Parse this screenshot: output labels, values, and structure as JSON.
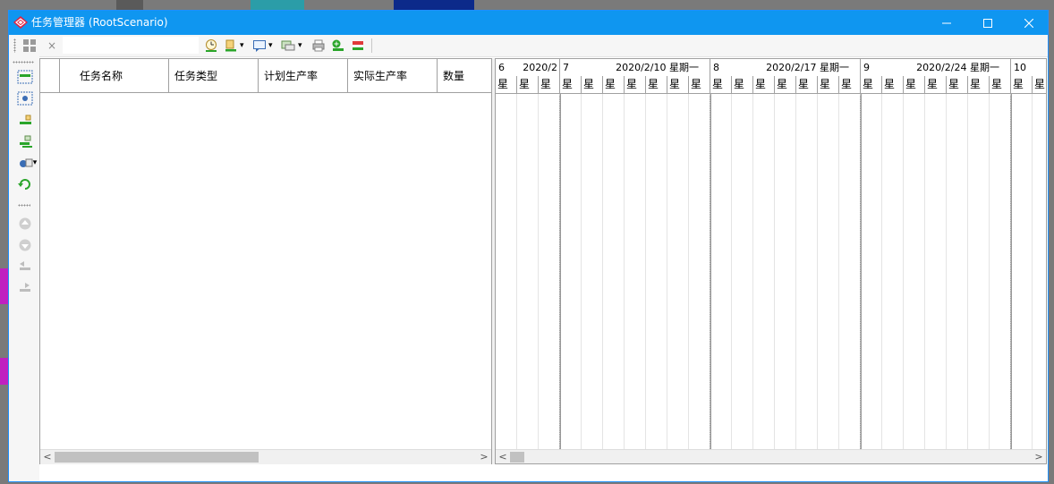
{
  "window": {
    "title": "任务管理器 (RootScenario)",
    "minimize_glyph": "—",
    "maximize_glyph": "☐",
    "close_glyph": "✕"
  },
  "toolbar": {
    "close_glyph": "×",
    "search_value": "",
    "dropdown_glyph": "▾"
  },
  "grid": {
    "columns": [
      "任务名称",
      "任务类型",
      "计划生产率",
      "实际生产率",
      "数量"
    ]
  },
  "gantt": {
    "weeks": [
      {
        "num": "6",
        "date": "2020/2"
      },
      {
        "num": "7",
        "date": "2020/2/10  星期一"
      },
      {
        "num": "8",
        "date": "2020/2/17  星期一"
      },
      {
        "num": "9",
        "date": "2020/2/24  星期一"
      },
      {
        "num": "10",
        "date": ""
      }
    ],
    "day_label": "星"
  },
  "scroll": {
    "left_glyph": "<",
    "right_glyph": ">"
  },
  "colors": {
    "titlebar": "#0f96f0",
    "accent_green": "#2aa52a"
  }
}
